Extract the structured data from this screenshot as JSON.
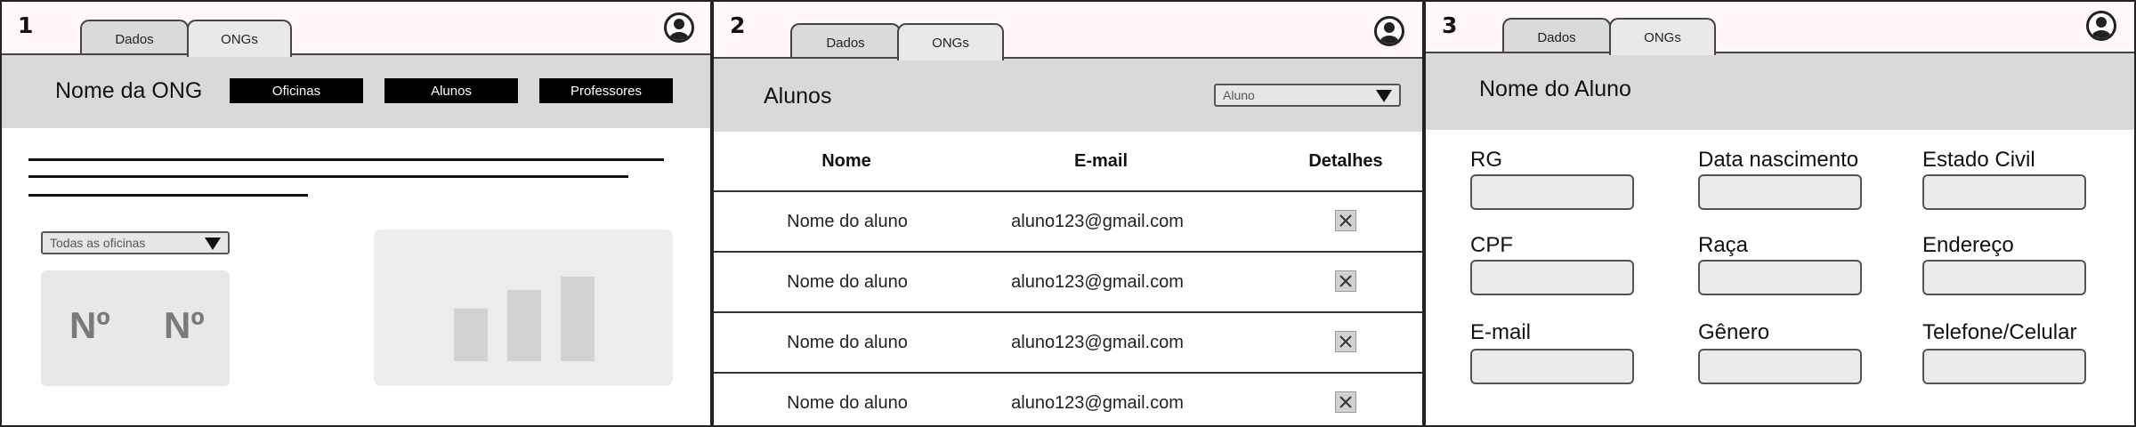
{
  "panels": [
    {
      "number": "1",
      "tabs": [
        "Dados",
        "ONGs"
      ],
      "title": "Nome da ONG",
      "buttons": [
        "Oficinas",
        "Alunos",
        "Professores"
      ],
      "dropdown": "Todas as oficinas",
      "stats": [
        "Nº",
        "Nº"
      ],
      "chart_data": {
        "type": "bar",
        "categories": [
          "",
          "",
          ""
        ],
        "values": [
          40,
          54,
          64
        ],
        "title": "",
        "xlabel": "",
        "ylabel": "",
        "ylim": [
          0,
          70
        ],
        "bar_color": "#d2d2d2"
      }
    },
    {
      "number": "2",
      "tabs": [
        "Dados",
        "ONGs"
      ],
      "title": "Alunos",
      "dropdown": "Aluno",
      "columns": [
        "Nome",
        "E-mail",
        "Detalhes"
      ],
      "rows": [
        {
          "name": "Nome do aluno",
          "email": "aluno123@gmail.com"
        },
        {
          "name": "Nome do aluno",
          "email": "aluno123@gmail.com"
        },
        {
          "name": "Nome do aluno",
          "email": "aluno123@gmail.com"
        },
        {
          "name": "Nome do aluno",
          "email": "aluno123@gmail.com"
        }
      ]
    },
    {
      "number": "3",
      "tabs": [
        "Dados",
        "ONGs"
      ],
      "title": "Nome do Aluno",
      "fields": [
        {
          "label": "RG",
          "value": ""
        },
        {
          "label": "Data nascimento",
          "value": ""
        },
        {
          "label": "Estado Civil",
          "value": ""
        },
        {
          "label": "CPF",
          "value": ""
        },
        {
          "label": "Raça",
          "value": ""
        },
        {
          "label": "Endereço",
          "value": ""
        },
        {
          "label": "E-mail",
          "value": ""
        },
        {
          "label": "Gênero",
          "value": ""
        },
        {
          "label": "Telefone/Celular",
          "value": ""
        }
      ]
    }
  ],
  "icons": {
    "user": "user-avatar-icon",
    "dropdown": "triangle-down-icon",
    "details": "close-x-icon"
  },
  "colors": {
    "header_band": "#d9d9d9",
    "topbar": "#fff7f8",
    "button_bg": "#000000",
    "card_bg": "#e8e8e8"
  }
}
